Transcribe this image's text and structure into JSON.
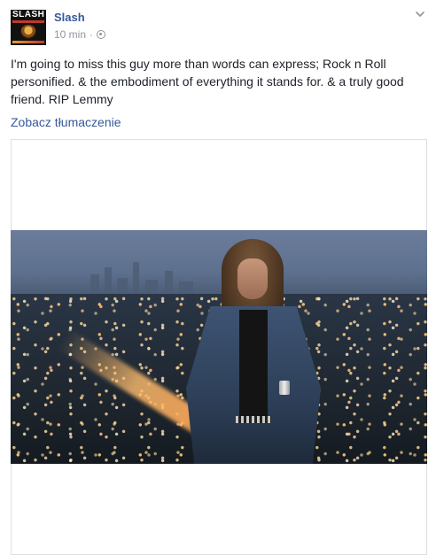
{
  "post": {
    "author": "Slash",
    "timestamp": "10 min",
    "separator": "·",
    "privacy_icon": "globe-icon",
    "menu_icon": "chevron-down-icon",
    "text": "I'm going to miss this guy more than words can express; Rock n Roll personified. & the embodiment of everything it stands for. & a truly good friend. RIP Lemmy",
    "translate_link": "Zobacz tłumaczenie"
  },
  "avatar": {
    "logo_text": "SLASH"
  },
  "colors": {
    "link": "#365899",
    "meta": "#90949c",
    "text": "#1d2129",
    "border": "#dddfe2"
  }
}
